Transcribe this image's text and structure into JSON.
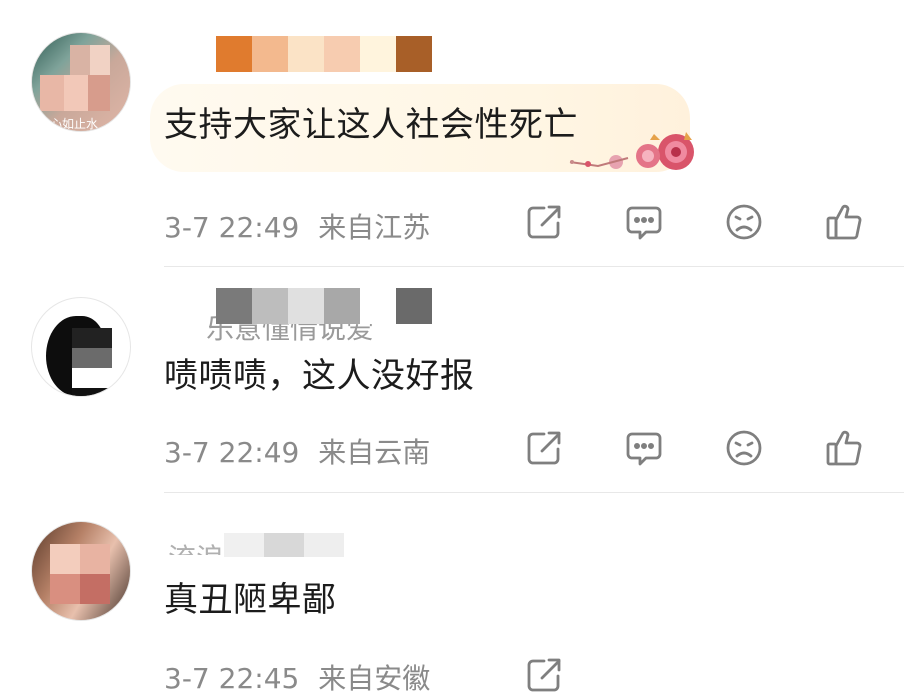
{
  "comments": [
    {
      "text": "支持大家让这人社会性死亡",
      "time": "3-7 22:49",
      "location": "来自江苏",
      "avatar_text": "心如止水",
      "name_colors": [
        "#e07b2e",
        "#f3b98e",
        "#fbe3c6",
        "#f7ccb0",
        "#fff4dd",
        "#a85f28"
      ]
    },
    {
      "text": "啧啧啧，这人没好报",
      "time": "3-7 22:49",
      "location": "来自云南",
      "name_text": "乐意懂情说爱",
      "name_colors": [
        "#7a7a7a",
        "#bdbdbd",
        "#e0e0e0",
        "#a8a8a8",
        "#ffffff",
        "#6a6a6a"
      ]
    },
    {
      "text": "真丑陋卑鄙",
      "time": "3-7 22:45",
      "location": "来自安徽",
      "name_text": "流浪在流浪"
    }
  ],
  "icons": [
    "share-icon",
    "comment-icon",
    "dislike-icon",
    "like-icon"
  ],
  "colors": {
    "text": "#1c1c1c",
    "meta": "#8a8a8a",
    "icon": "#7f7f7f",
    "divider": "#e8e8e8"
  }
}
